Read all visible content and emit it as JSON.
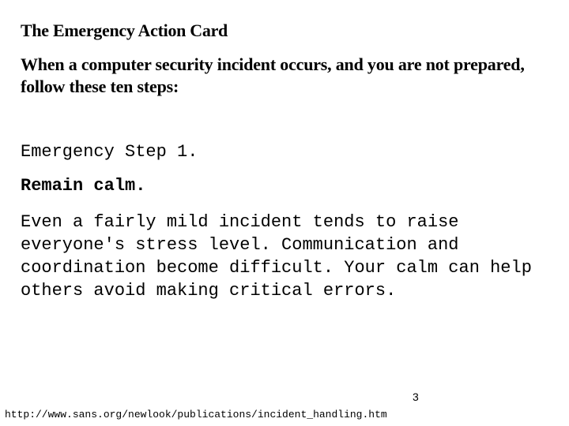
{
  "document": {
    "title": "The Emergency Action Card",
    "intro": "When a computer security incident occurs, and you are not prepared, follow these ten steps:",
    "step": {
      "label": "Emergency Step 1.",
      "heading": "Remain calm.",
      "body": "Even a fairly mild incident tends to raise everyone's stress level. Communication and coordination become difficult. Your calm can help others avoid making critical errors."
    },
    "page_number": "3",
    "footer_url": "http://www.sans.org/newlook/publications/incident_handling.htm"
  }
}
